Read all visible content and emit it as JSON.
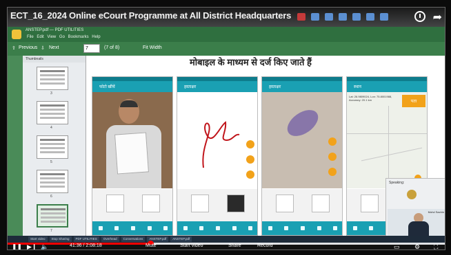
{
  "youtube": {
    "title": "ECT_16_2024 Online eCourt Programme at All District Headquarters",
    "time_display": "41:36 / 2:08:18",
    "progress_fraction": 0.325
  },
  "pdf_app": {
    "app_name": "ANSTEP.pdf — PDF UTILITIES",
    "menu": "File  Edit  View  Go  Bookmarks  Help",
    "previous_label": "Previous",
    "next_label": "Next",
    "page_value": "7",
    "page_of": "(7 of 8)",
    "fit_label": "Fit Width"
  },
  "thumbnails": {
    "header": "Thumbnails",
    "pages": [
      "3",
      "4",
      "5",
      "6",
      "7"
    ]
  },
  "document": {
    "heading": "मोबाइल के माध्यम से दर्ज किए जाते हैं",
    "phones": [
      {
        "appbar": "फोटो खींचें"
      },
      {
        "appbar": "हस्ताक्षर"
      },
      {
        "appbar": "हस्ताक्षर"
      },
      {
        "appbar": "स्थान"
      }
    ],
    "map_location_text": "Lat: 26.9809024, Lon: 75.8001988, Accuracy: 20.1 km",
    "map_button": "पता"
  },
  "meeting": {
    "speaking_label": "Speaking:",
    "participant_name": "Mohd Sachin"
  },
  "taskbar_items": [
    "Start video",
    "Stop Sharing",
    "PDF UTILITIES",
    "Overhead",
    "Conversations",
    "ANSTEP.pdf",
    "ANSTEP.pdf"
  ],
  "controls": {
    "mute_label": "Mute",
    "start_video_label": "Start video",
    "share_label": "Share",
    "record_label": "Record"
  }
}
